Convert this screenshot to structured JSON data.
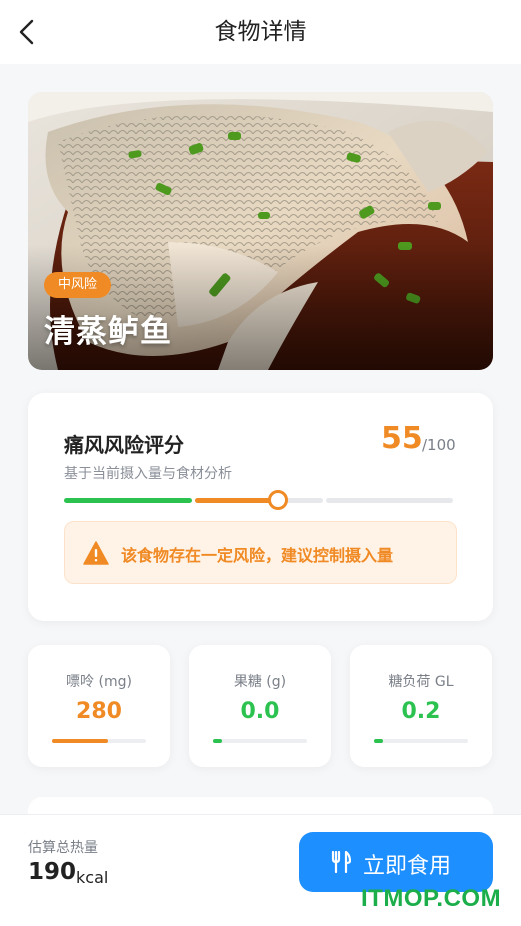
{
  "header": {
    "title": "食物详情"
  },
  "hero": {
    "risk_badge": "中风险",
    "dish_name": "清蒸鲈鱼"
  },
  "score": {
    "title": "痛风风险评分",
    "subtitle": "基于当前摄入量与食材分析",
    "value": "55",
    "max": "/100",
    "level_fraction": 0.55,
    "warning": "该食物存在一定风险，建议控制摄入量",
    "colors": {
      "low": "#2cc24f",
      "mid": "#f08a24",
      "rest": "#e6e8eb"
    }
  },
  "nutrients": [
    {
      "label": "嘌呤 (mg)",
      "value": "280",
      "color": "#f08a24",
      "level": 0.6
    },
    {
      "label": "果糖 (g)",
      "value": "0.0",
      "color": "#2cc24f",
      "level": 0.1
    },
    {
      "label": "糖负荷 GL",
      "value": "0.2",
      "color": "#2cc24f",
      "level": 0.1
    }
  ],
  "bottom": {
    "calorie_label": "估算总热量",
    "calorie_value": "190",
    "calorie_unit": "kcal",
    "eat_button": "立即食用"
  },
  "watermark": "ITMOP.COM",
  "icons": {
    "back": "chevron-left-icon",
    "warning": "warning-triangle-icon",
    "eat": "fork-knife-icon"
  }
}
